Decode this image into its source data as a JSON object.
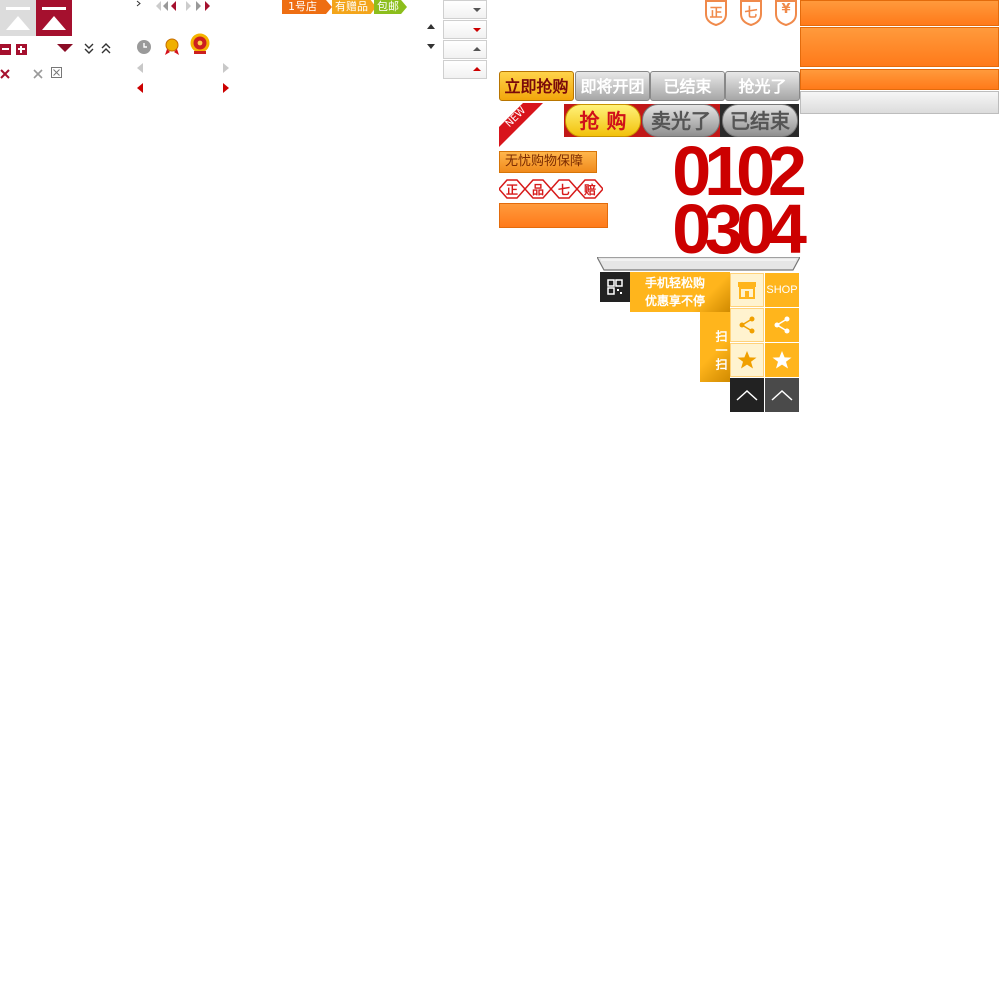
{
  "tags": {
    "store": "1号店",
    "gift": "有赠品",
    "shipping": "包邮"
  },
  "sale_buttons": {
    "buy_now": "立即抢购",
    "coming_soon": "即将开团",
    "ended": "已结束",
    "sold_out": "抢光了"
  },
  "pill_buttons": {
    "buy": "抢 购",
    "sold_out": "卖光了",
    "ended": "已结束"
  },
  "badges": {
    "new": "NEW",
    "guarantee": "无忧购物保障",
    "authentic": "正",
    "product": "品",
    "seven": "七",
    "compensate": "赔"
  },
  "shield_icons": {
    "authentic": "正",
    "seven_day": "七",
    "yuan": "¥"
  },
  "digits": {
    "row1": "0102",
    "row2": "0304"
  },
  "mobile_promo": {
    "line1": "手机轻松购",
    "line2": "优惠享不停",
    "scan": "扫一扫"
  },
  "side_toolbar": {
    "shop_label": "SHOP"
  },
  "colors": {
    "brand_red": "#a5102e",
    "orange": "#ff8a2a",
    "yellow_orange": "#ffb81c",
    "digit_red": "#cc0000",
    "dark": "#222222"
  },
  "icons": [
    "back-to-top-gray-icon",
    "back-to-top-red-icon",
    "collapse-icon",
    "expand-icon",
    "triangle-down-icon",
    "double-chevron-down-icon",
    "double-chevron-up-icon",
    "close-icon",
    "close-gray-icon",
    "checkbox-x-icon",
    "clock-icon",
    "award-icon",
    "police-badge-icon",
    "qr-code-icon",
    "shop-icon",
    "share-icon",
    "star-icon",
    "up-arrow-icon"
  ]
}
